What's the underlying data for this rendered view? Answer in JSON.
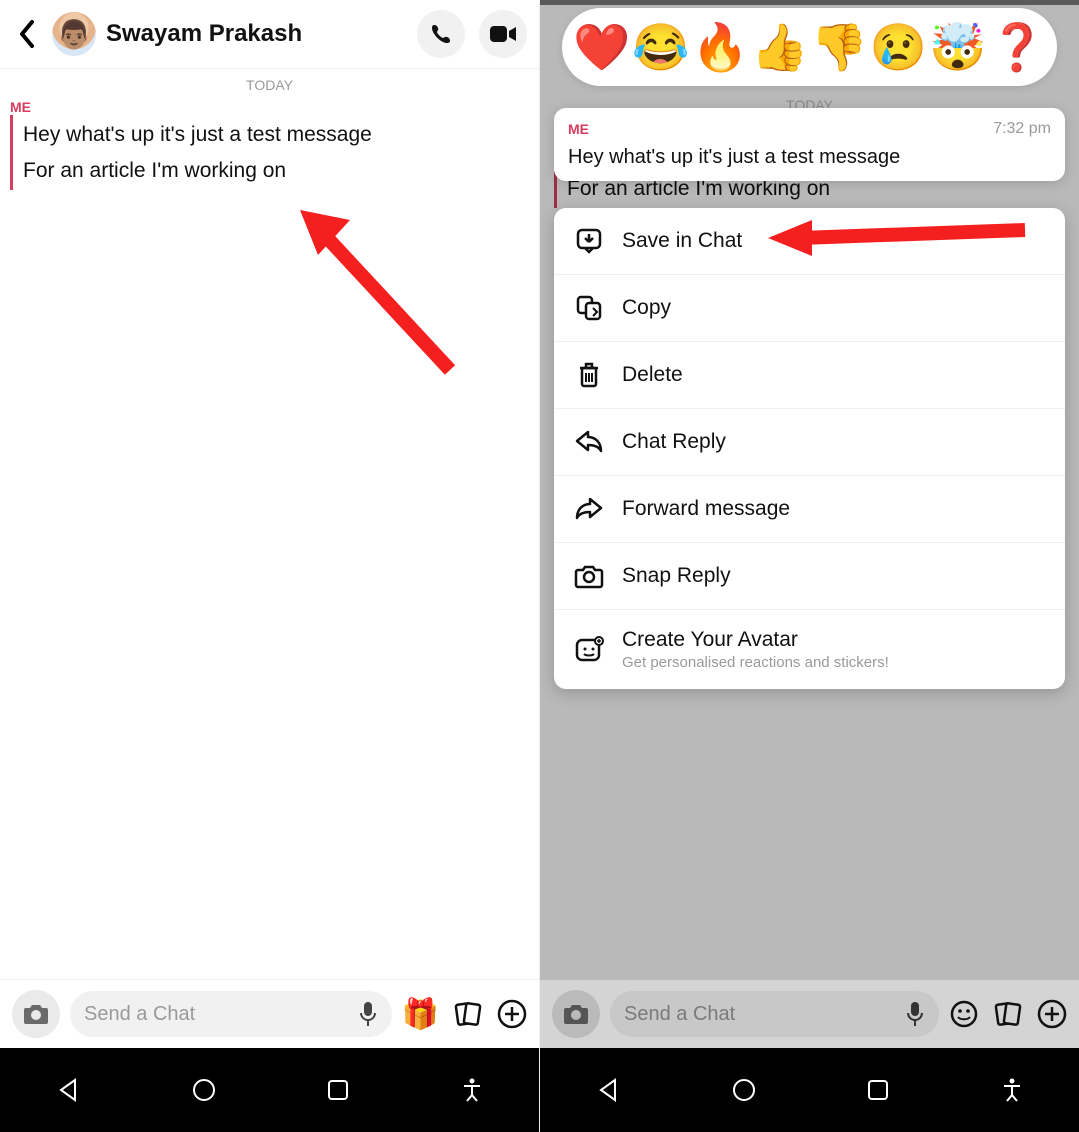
{
  "left": {
    "header": {
      "name": "Swayam Prakash"
    },
    "today_label": "TODAY",
    "me_label": "ME",
    "messages": [
      "Hey what's up it's just a test message",
      "For an article I'm working on"
    ],
    "input_placeholder": "Send a Chat"
  },
  "right": {
    "reactions": [
      "❤️",
      "😂",
      "🔥",
      "👍",
      "👎",
      "😢",
      "🤯",
      "❓"
    ],
    "bg_today": "TODAY",
    "bg_me": "ME",
    "preview": {
      "me": "ME",
      "time": "7:32 pm",
      "msg": "Hey what's up it's just a test message"
    },
    "menu": [
      {
        "icon": "save",
        "label": "Save in Chat"
      },
      {
        "icon": "copy",
        "label": "Copy"
      },
      {
        "icon": "delete",
        "label": "Delete"
      },
      {
        "icon": "reply",
        "label": "Chat Reply"
      },
      {
        "icon": "forward",
        "label": "Forward message"
      },
      {
        "icon": "snap",
        "label": "Snap Reply"
      },
      {
        "icon": "avatar",
        "label": "Create Your Avatar",
        "sub": "Get personalised reactions and stickers!"
      }
    ],
    "input_placeholder": "Send a Chat"
  },
  "colors": {
    "accent": "#d63d5e",
    "arrow": "#f41f1f"
  }
}
